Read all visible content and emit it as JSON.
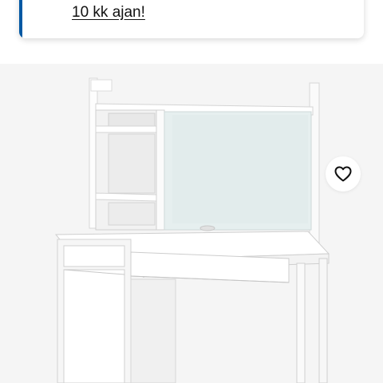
{
  "promo": {
    "link_text": "10 kk ajan!"
  },
  "favorite": {
    "icon": "heart-outline-icon"
  },
  "colors": {
    "accent": "#0058a3",
    "image_background": "#f5f5f5"
  }
}
